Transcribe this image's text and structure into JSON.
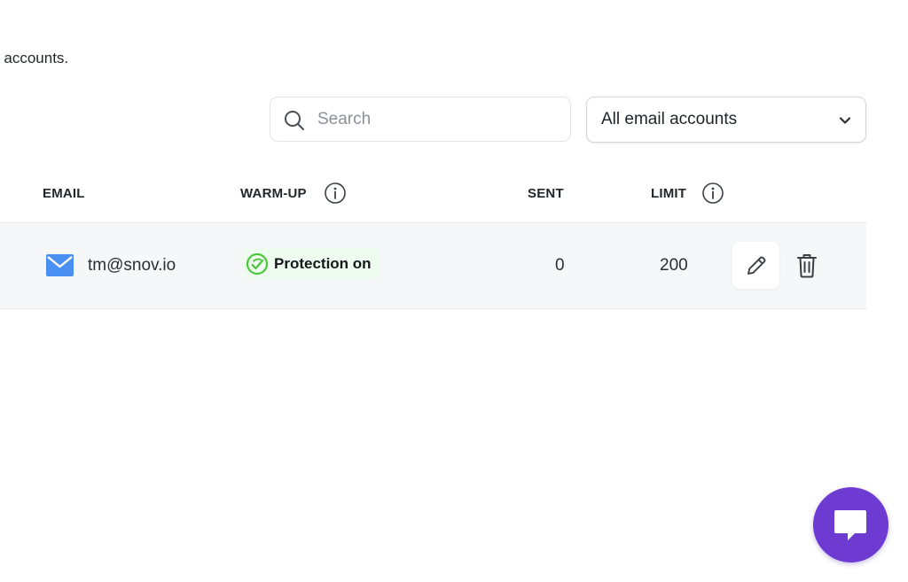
{
  "header": {
    "subtitle": "r accounts."
  },
  "toolbar": {
    "search": {
      "placeholder": "Search",
      "value": "",
      "icon": "search-icon"
    },
    "filter": {
      "selected": "All email accounts",
      "icon": "chevron-down-icon"
    }
  },
  "table": {
    "columns": {
      "email": "EMAIL",
      "warmup": "WARM-UP",
      "sent": "SENT",
      "limit": "LIMIT"
    },
    "rows": [
      {
        "email": "tm@snov.io",
        "warmup_status": "Protection on",
        "sent": "0",
        "limit": "200"
      }
    ]
  },
  "colors": {
    "accent_blue": "#4a90f2",
    "warmup_green": "#4cc73c",
    "warmup_badge_bg": "#eefcef",
    "chat_purple": "#6d3bd1",
    "row_bg": "#f6f7f9"
  },
  "icons": {
    "row_email": "envelope-icon",
    "warmup": "shield-check-icon",
    "info": "info-icon",
    "edit": "pencil-icon",
    "delete": "trash-icon",
    "chat": "chat-bubble-icon"
  }
}
